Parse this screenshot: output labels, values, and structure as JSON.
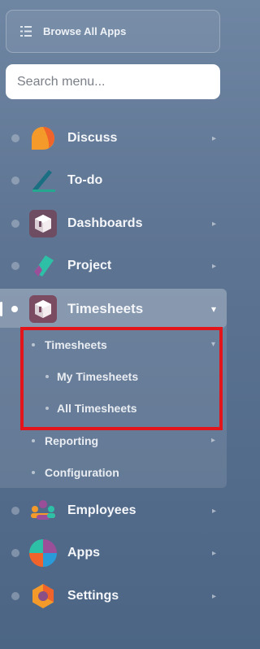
{
  "browse": {
    "label": "Browse All Apps",
    "icon": "menu-list-icon"
  },
  "search": {
    "placeholder": "Search menu..."
  },
  "apps": [
    {
      "label": "Discuss",
      "icon": "discuss-icon",
      "has_arrow": true
    },
    {
      "label": "To-do",
      "icon": "todo-icon",
      "has_arrow": false
    },
    {
      "label": "Dashboards",
      "icon": "dashboards-icon",
      "has_arrow": true
    },
    {
      "label": "Project",
      "icon": "project-icon",
      "has_arrow": true
    },
    {
      "label": "Timesheets",
      "icon": "timesheets-icon",
      "has_arrow": true,
      "expanded": true
    },
    {
      "label": "Employees",
      "icon": "employees-icon",
      "has_arrow": true
    },
    {
      "label": "Apps",
      "icon": "apps-icon",
      "has_arrow": true
    },
    {
      "label": "Settings",
      "icon": "settings-icon",
      "has_arrow": true
    }
  ],
  "timesheets_submenu": {
    "group_label": "Timesheets",
    "children": [
      "My Timesheets",
      "All Timesheets"
    ],
    "reporting": "Reporting",
    "configuration": "Configuration"
  },
  "arrows": {
    "collapsed": "▸",
    "expanded": "▾"
  },
  "colors": {
    "highlight_border": "#e3141a",
    "background_top": "#6f86a3",
    "background_bottom": "#4c6585"
  }
}
